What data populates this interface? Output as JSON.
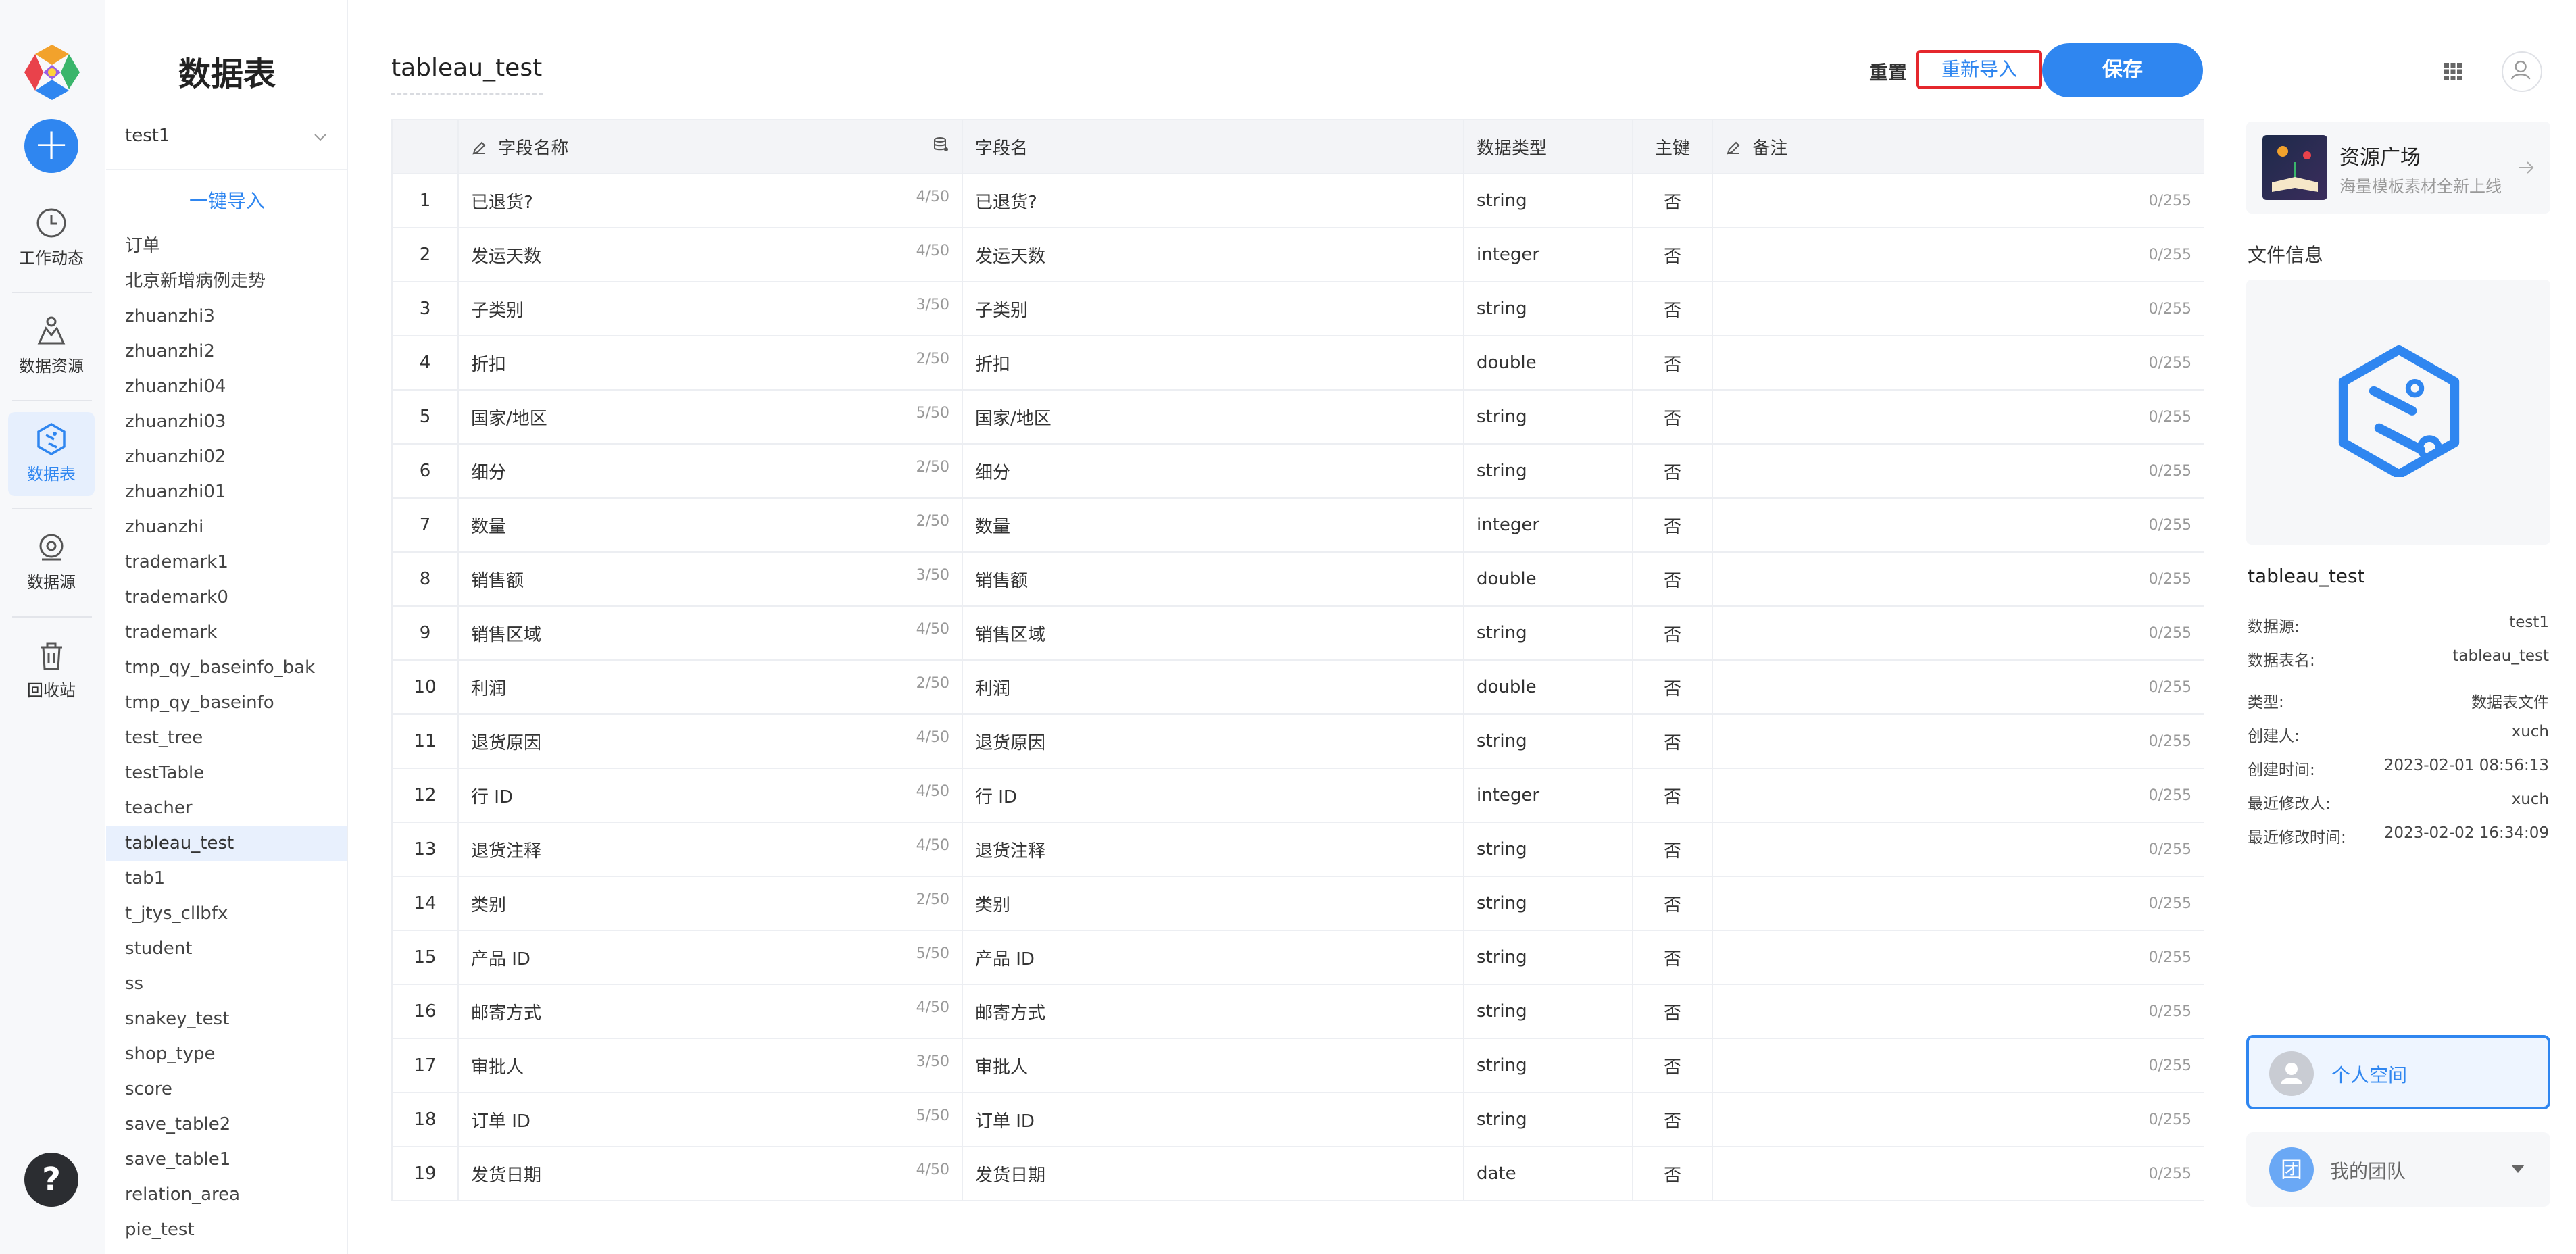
{
  "rail": {
    "items": [
      {
        "label": "工作动态",
        "icon": "clock-icon"
      },
      {
        "label": "数据资源",
        "icon": "data-resource-icon"
      },
      {
        "label": "数据表",
        "icon": "data-table-icon",
        "active": true
      },
      {
        "label": "数据源",
        "icon": "data-source-icon"
      },
      {
        "label": "回收站",
        "icon": "trash-icon"
      }
    ],
    "help": "?"
  },
  "list": {
    "title": "数据表",
    "selected_source": "test1",
    "import_label": "一键导入",
    "items": [
      "订单",
      "北京新增病例走势",
      "zhuanzhi3",
      "zhuanzhi2",
      "zhuanzhi04",
      "zhuanzhi03",
      "zhuanzhi02",
      "zhuanzhi01",
      "zhuanzhi",
      "trademark1",
      "trademark0",
      "trademark",
      "tmp_qy_baseinfo_bak",
      "tmp_qy_baseinfo",
      "test_tree",
      "testTable",
      "teacher",
      "tableau_test",
      "tab1",
      "t_jtys_cllbfx",
      "student",
      "ss",
      "snakey_test",
      "shop_type",
      "score",
      "save_table2",
      "save_table1",
      "relation_area",
      "pie_test"
    ],
    "active_item": "tableau_test"
  },
  "main": {
    "title": "tableau_test",
    "reset_label": "重置",
    "reimport_label": "重新导入",
    "save_label": "保存",
    "columns": [
      "",
      "字段名称",
      "字段名",
      "数据类型",
      "主键",
      "备注"
    ],
    "rows": [
      {
        "idx": "1",
        "name": "已退货?",
        "count": "4/50",
        "field": "已退货?",
        "type": "string",
        "pk": "否",
        "note": "0/255"
      },
      {
        "idx": "2",
        "name": "发运天数",
        "count": "4/50",
        "field": "发运天数",
        "type": "integer",
        "pk": "否",
        "note": "0/255"
      },
      {
        "idx": "3",
        "name": "子类别",
        "count": "3/50",
        "field": "子类别",
        "type": "string",
        "pk": "否",
        "note": "0/255"
      },
      {
        "idx": "4",
        "name": "折扣",
        "count": "2/50",
        "field": "折扣",
        "type": "double",
        "pk": "否",
        "note": "0/255"
      },
      {
        "idx": "5",
        "name": "国家/地区",
        "count": "5/50",
        "field": "国家/地区",
        "type": "string",
        "pk": "否",
        "note": "0/255"
      },
      {
        "idx": "6",
        "name": "细分",
        "count": "2/50",
        "field": "细分",
        "type": "string",
        "pk": "否",
        "note": "0/255"
      },
      {
        "idx": "7",
        "name": "数量",
        "count": "2/50",
        "field": "数量",
        "type": "integer",
        "pk": "否",
        "note": "0/255"
      },
      {
        "idx": "8",
        "name": "销售额",
        "count": "3/50",
        "field": "销售额",
        "type": "double",
        "pk": "否",
        "note": "0/255"
      },
      {
        "idx": "9",
        "name": "销售区域",
        "count": "4/50",
        "field": "销售区域",
        "type": "string",
        "pk": "否",
        "note": "0/255"
      },
      {
        "idx": "10",
        "name": "利润",
        "count": "2/50",
        "field": "利润",
        "type": "double",
        "pk": "否",
        "note": "0/255"
      },
      {
        "idx": "11",
        "name": "退货原因",
        "count": "4/50",
        "field": "退货原因",
        "type": "string",
        "pk": "否",
        "note": "0/255"
      },
      {
        "idx": "12",
        "name": "行 ID",
        "count": "4/50",
        "field": "行 ID",
        "type": "integer",
        "pk": "否",
        "note": "0/255"
      },
      {
        "idx": "13",
        "name": "退货注释",
        "count": "4/50",
        "field": "退货注释",
        "type": "string",
        "pk": "否",
        "note": "0/255"
      },
      {
        "idx": "14",
        "name": "类别",
        "count": "2/50",
        "field": "类别",
        "type": "string",
        "pk": "否",
        "note": "0/255"
      },
      {
        "idx": "15",
        "name": "产品 ID",
        "count": "5/50",
        "field": "产品 ID",
        "type": "string",
        "pk": "否",
        "note": "0/255"
      },
      {
        "idx": "16",
        "name": "邮寄方式",
        "count": "4/50",
        "field": "邮寄方式",
        "type": "string",
        "pk": "否",
        "note": "0/255"
      },
      {
        "idx": "17",
        "name": "审批人",
        "count": "3/50",
        "field": "审批人",
        "type": "string",
        "pk": "否",
        "note": "0/255"
      },
      {
        "idx": "18",
        "name": "订单 ID",
        "count": "5/50",
        "field": "订单 ID",
        "type": "string",
        "pk": "否",
        "note": "0/255"
      },
      {
        "idx": "19",
        "name": "发货日期",
        "count": "4/50",
        "field": "发货日期",
        "type": "date",
        "pk": "否",
        "note": "0/255"
      }
    ]
  },
  "side": {
    "resource": {
      "title": "资源广场",
      "subtitle": "海量模板素材全新上线"
    },
    "file_info_label": "文件信息",
    "file_name": "tableau_test",
    "meta": [
      {
        "k": "数据源:",
        "v": "test1"
      },
      {
        "k": "数据表名:",
        "v": "tableau_test"
      },
      {
        "k": "类型:",
        "v": "数据表文件"
      },
      {
        "k": "创建人:",
        "v": "xuch"
      },
      {
        "k": "创建时间:",
        "v": "2023-02-01 08:56:13"
      },
      {
        "k": "最近修改人:",
        "v": "xuch"
      },
      {
        "k": "最近修改时间:",
        "v": "2023-02-02 16:34:09"
      }
    ],
    "personal_space": "个人空间",
    "team": {
      "badge": "团",
      "label": "我的团队"
    }
  },
  "colors": {
    "accent": "#2f86f0",
    "highlight_border": "#e5272d"
  }
}
